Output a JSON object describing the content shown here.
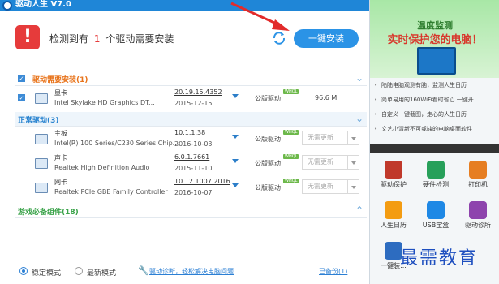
{
  "window": {
    "title": "驱动人生 V7.0",
    "close_label": "×"
  },
  "header": {
    "prefix": "检测到有",
    "count": "1",
    "suffix": "个驱动需要安装",
    "install_button": "一键安装"
  },
  "sections": {
    "needs_install": "驱动需要安装(1)",
    "normal": "正常驱动(3)",
    "games": "游戏必备组件(18)"
  },
  "rows": [
    {
      "name": "显卡",
      "desc": "Intel Skylake HD Graphics DT...",
      "version": "20.19.15.4352",
      "date": "2015-12-15",
      "driver_type": "公版驱动",
      "badge": "WHQL",
      "size": "96.6 M"
    },
    {
      "name": "主板",
      "desc": "Intel(R) 100 Series/C230 Series Chip...",
      "version": "10.1.1.38",
      "date": "2016-10-03",
      "driver_type": "公版驱动",
      "badge": "WHQL",
      "select": "无需更新"
    },
    {
      "name": "声卡",
      "desc": "Realtek High Definition Audio",
      "version": "6.0.1.7661",
      "date": "2015-11-10",
      "driver_type": "公版驱动",
      "badge": "WHQL",
      "select": "无需更新"
    },
    {
      "name": "网卡",
      "desc": "Realtek PCIe GBE Family Controller",
      "version": "10.12.1007.2016",
      "date": "2016-10-07",
      "driver_type": "公版驱动",
      "badge": "WHQL",
      "select": "无需更新"
    }
  ],
  "footer": {
    "mode_stable": "稳定模式",
    "mode_latest": "最新模式",
    "diagnose_link": "驱动诊断，轻松解决电脑问题",
    "backup_link": "已备份(1)"
  },
  "right_panel": {
    "banner_title": "温度监测",
    "banner_subtitle": "实时保护您的电脑！",
    "tips": [
      "陆陆电脑观测有脑，监测人生日历",
      "简单易用的160WiFi看时省心 一键开...",
      "自定义一键截图，走心的人生日历",
      "文艺小清新不可或缺的电脑桌面软件"
    ],
    "tools": [
      {
        "label": "驱动保护",
        "color": "#c0392b"
      },
      {
        "label": "硬件检测",
        "color": "#27a05a"
      },
      {
        "label": "打印机",
        "color": "#e67e22"
      },
      {
        "label": "人生日历",
        "color": "#f39c12"
      },
      {
        "label": "USB宝盒",
        "color": "#1e88e5"
      },
      {
        "label": "驱动诊所",
        "color": "#8e44ad"
      },
      {
        "label": "一键装...",
        "color": "#2d6cc0"
      }
    ],
    "watermark": "最需教育"
  }
}
